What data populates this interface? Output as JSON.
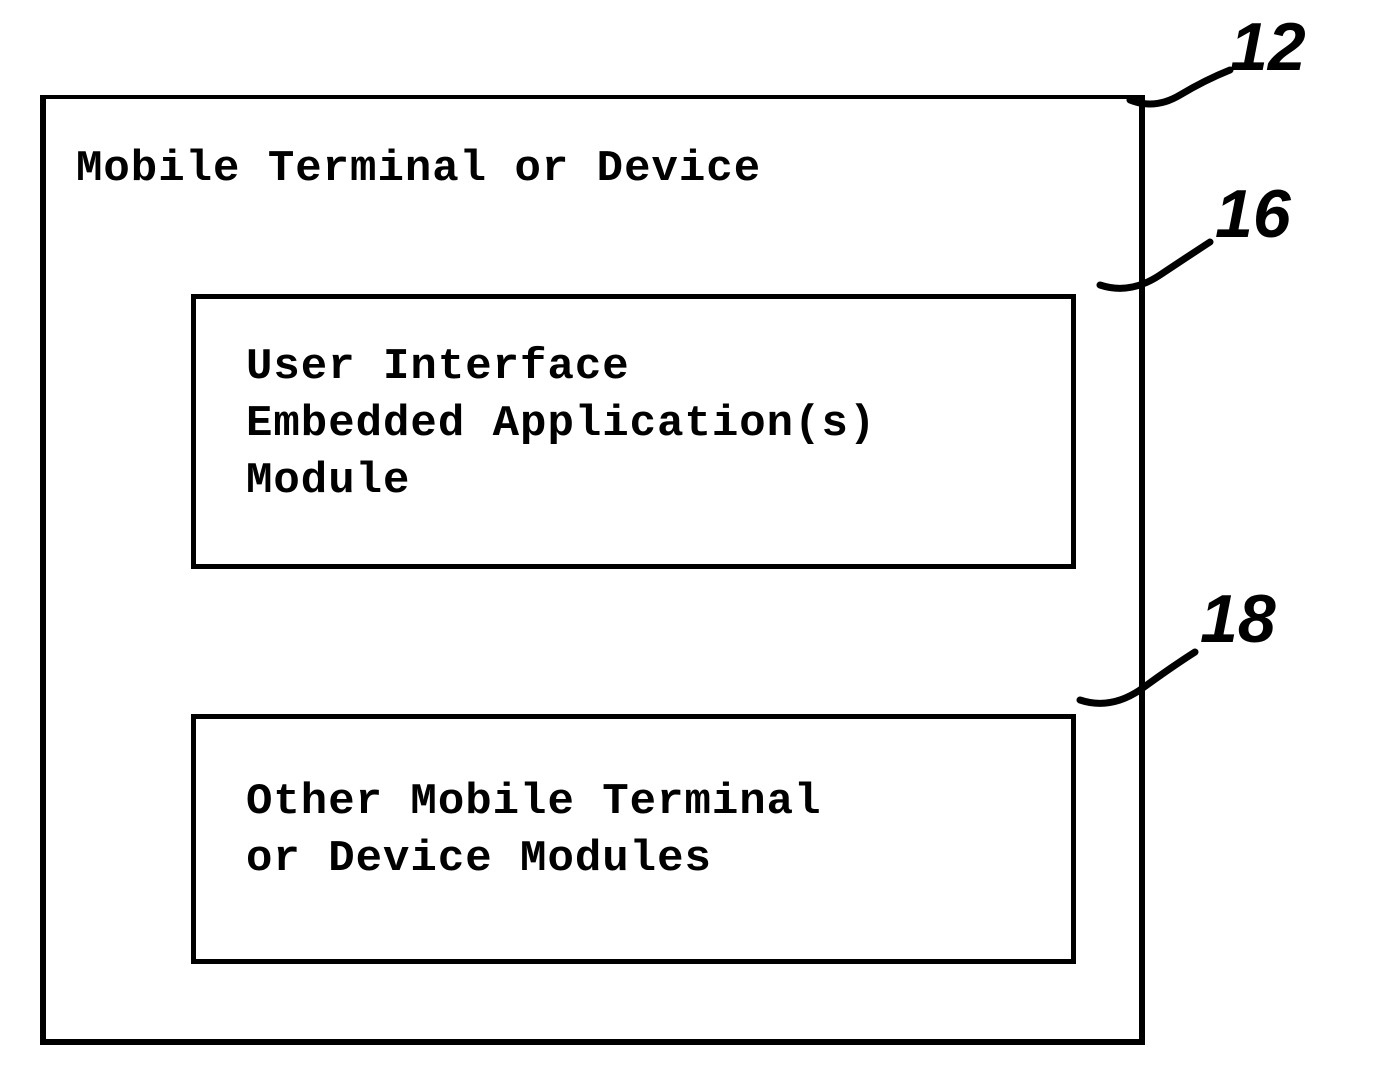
{
  "outerBox": {
    "title": "Mobile Terminal or Device",
    "refNum": "12"
  },
  "innerBox1": {
    "line1": "User Interface",
    "line2": "Embedded Application(s)",
    "line3": "Module",
    "refNum": "16"
  },
  "innerBox2": {
    "line1": "Other Mobile Terminal",
    "line2": "or Device Modules",
    "refNum": "18"
  }
}
